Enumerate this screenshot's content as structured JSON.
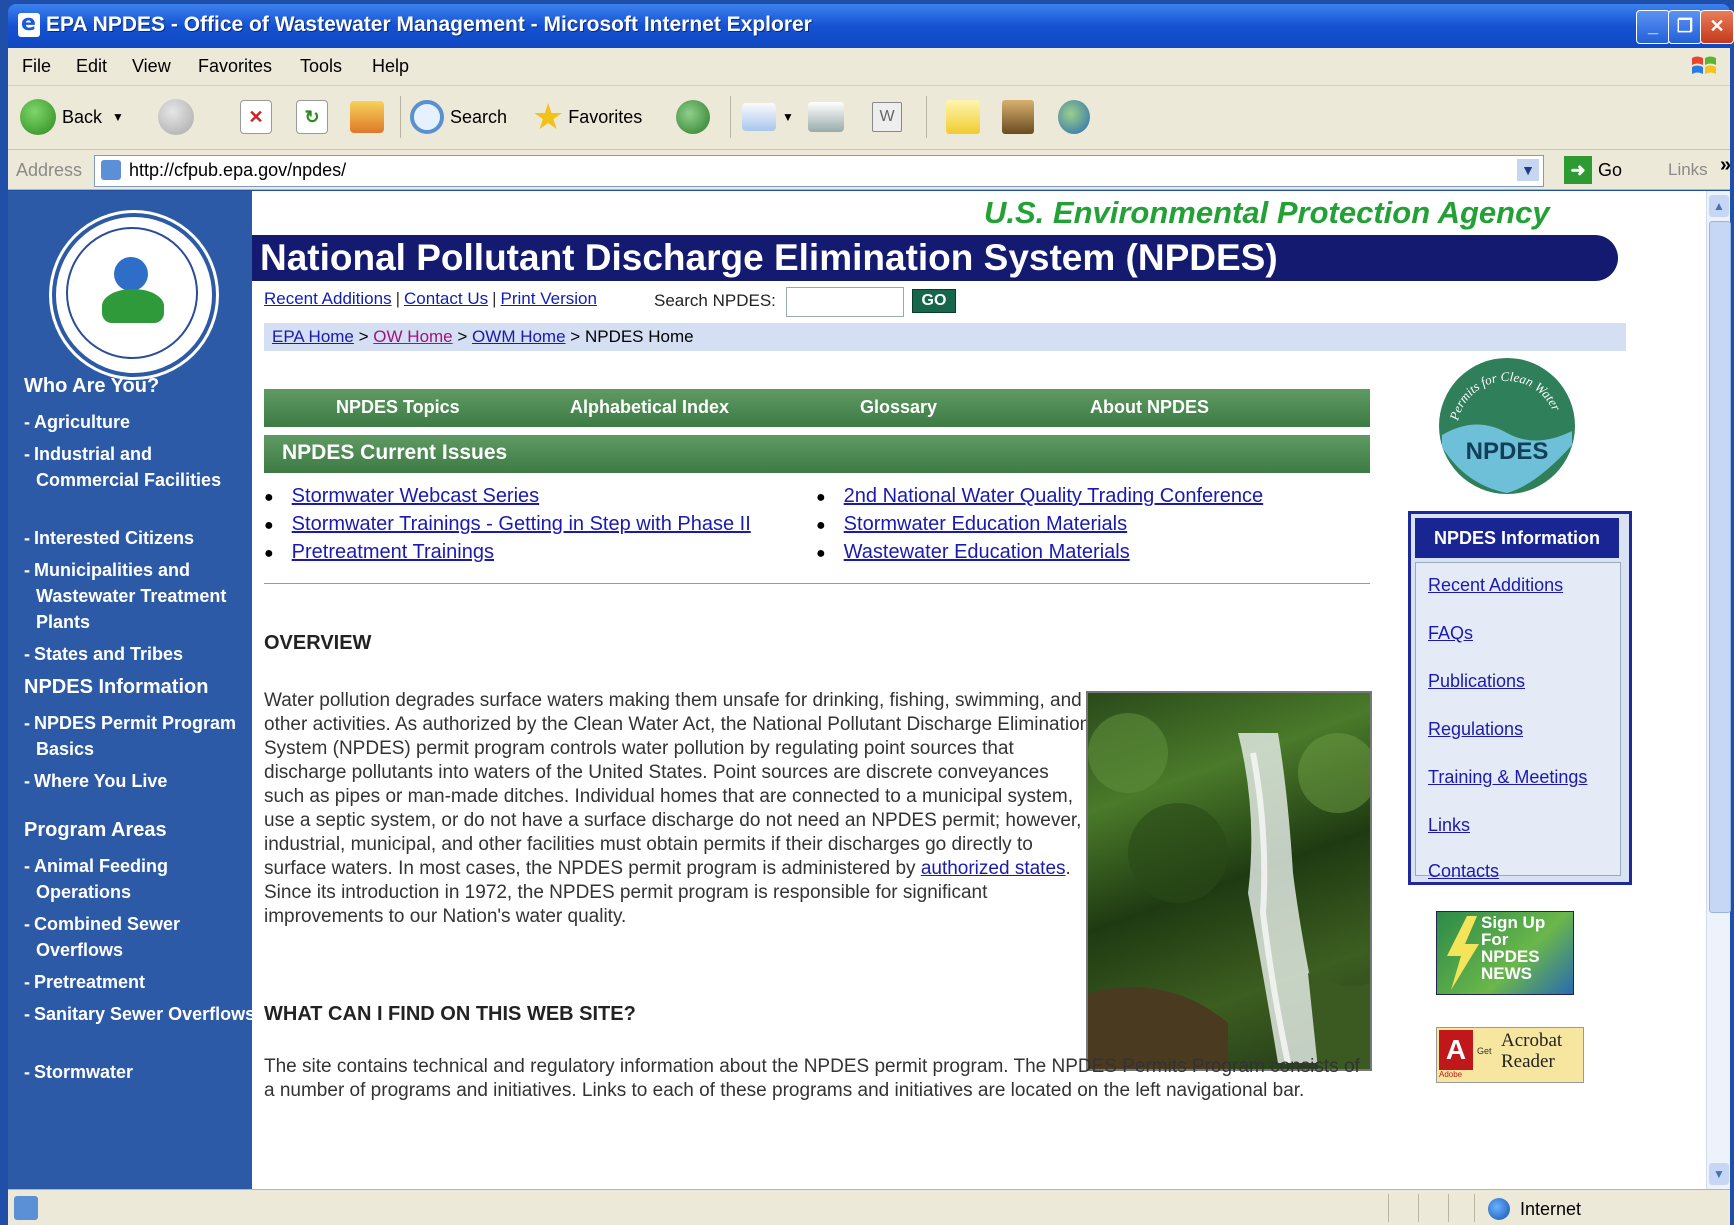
{
  "window": {
    "title": "EPA NPDES - Office of Wastewater Management - Microsoft Internet Explorer"
  },
  "menu": [
    "File",
    "Edit",
    "View",
    "Favorites",
    "Tools",
    "Help"
  ],
  "toolbar": {
    "back": "Back",
    "search": "Search",
    "favorites": "Favorites"
  },
  "address": {
    "label": "Address",
    "url": "http://cfpub.epa.gov/npdes/",
    "go": "Go",
    "links": "Links"
  },
  "page": {
    "agency": "U.S. Environmental Protection Agency",
    "banner": "National Pollutant Discharge Elimination System (NPDES)",
    "toplinks": [
      "Recent Additions",
      "Contact Us",
      "Print Version"
    ],
    "search_label": "Search NPDES:",
    "search_value": "",
    "search_go": "GO",
    "breadcrumb": {
      "items": [
        "EPA Home",
        "OW Home",
        "OWM Home"
      ],
      "current": "NPDES Home",
      "sep": ">"
    },
    "topic_nav": [
      "NPDES Topics",
      "Alphabetical Index",
      "Glossary",
      "About NPDES"
    ],
    "issues_title": "NPDES Current Issues",
    "issues_left": [
      "Stormwater Webcast Series",
      "Stormwater Trainings - Getting in Step with Phase II",
      "Pretreatment Trainings"
    ],
    "issues_right": [
      "2nd National Water Quality Trading Conference",
      "Stormwater Education Materials",
      "Wastewater Education Materials"
    ],
    "overview_heading": "OVERVIEW",
    "overview_text_1": "Water pollution degrades surface waters making them unsafe for drinking, fishing, swimming, and other activities. As authorized by the Clean Water Act, the National Pollutant Discharge Elimination System (NPDES) permit program controls water pollution by regulating point sources that discharge pollutants into waters of the United States. Point sources are discrete conveyances such as pipes or man-made ditches. Individual homes that are connected to a municipal system, use a septic system, or do not have a surface discharge do not need an NPDES permit; however, industrial, municipal, and other facilities must obtain permits if their discharges go directly to surface waters. In most cases, the NPDES permit program is administered by",
    "overview_link": "authorized states",
    "overview_text_2": ". Since its introduction in 1972, the NPDES permit program is responsible for significant improvements to our Nation's water quality.",
    "find_heading": "WHAT CAN I FIND ON THIS WEB SITE?",
    "find_text": "The site contains technical and regulatory information about the NPDES permit program. The NPDES Permits Program consists of a number of programs and initiatives. Links to each of these programs and initiatives are located on the left navigational bar."
  },
  "leftnav": {
    "sections": [
      {
        "heading": "Who Are You?",
        "items": [
          "Agriculture",
          "Industrial and Commercial Facilities",
          "Interested Citizens",
          "Municipalities and Wastewater Treatment Plants",
          "States and Tribes"
        ]
      },
      {
        "heading": "NPDES Information",
        "items": [
          "NPDES Permit Program Basics",
          "Where You Live"
        ]
      },
      {
        "heading": "Program Areas",
        "items": [
          "Animal Feeding Operations",
          "Combined Sewer Overflows",
          "Pretreatment",
          "Sanitary Sewer Overflows",
          "Stormwater"
        ]
      }
    ],
    "bullet": "-"
  },
  "rightcol": {
    "info_title": "NPDES Information",
    "info_links": [
      "Recent Additions",
      "FAQs",
      "Publications",
      "Regulations",
      "Training & Meetings",
      "Links",
      "Contacts"
    ],
    "signup": "Sign Up For NPDES NEWS",
    "acrobat_get": "Get",
    "acrobat_name": "Acrobat Reader",
    "acrobat_brand": "Adobe",
    "logo_text": "NPDES",
    "logo_arc": "Permits for Clean Water"
  },
  "status": {
    "zone": "Internet"
  },
  "colors": {
    "titlebar": "#1552d2",
    "leftnav": "#2d5aa6",
    "banner": "#131a70",
    "agency_green": "#23a036",
    "topic_green": "#3e7a44",
    "link": "#1a1ab0",
    "visited": "#a0147a"
  }
}
